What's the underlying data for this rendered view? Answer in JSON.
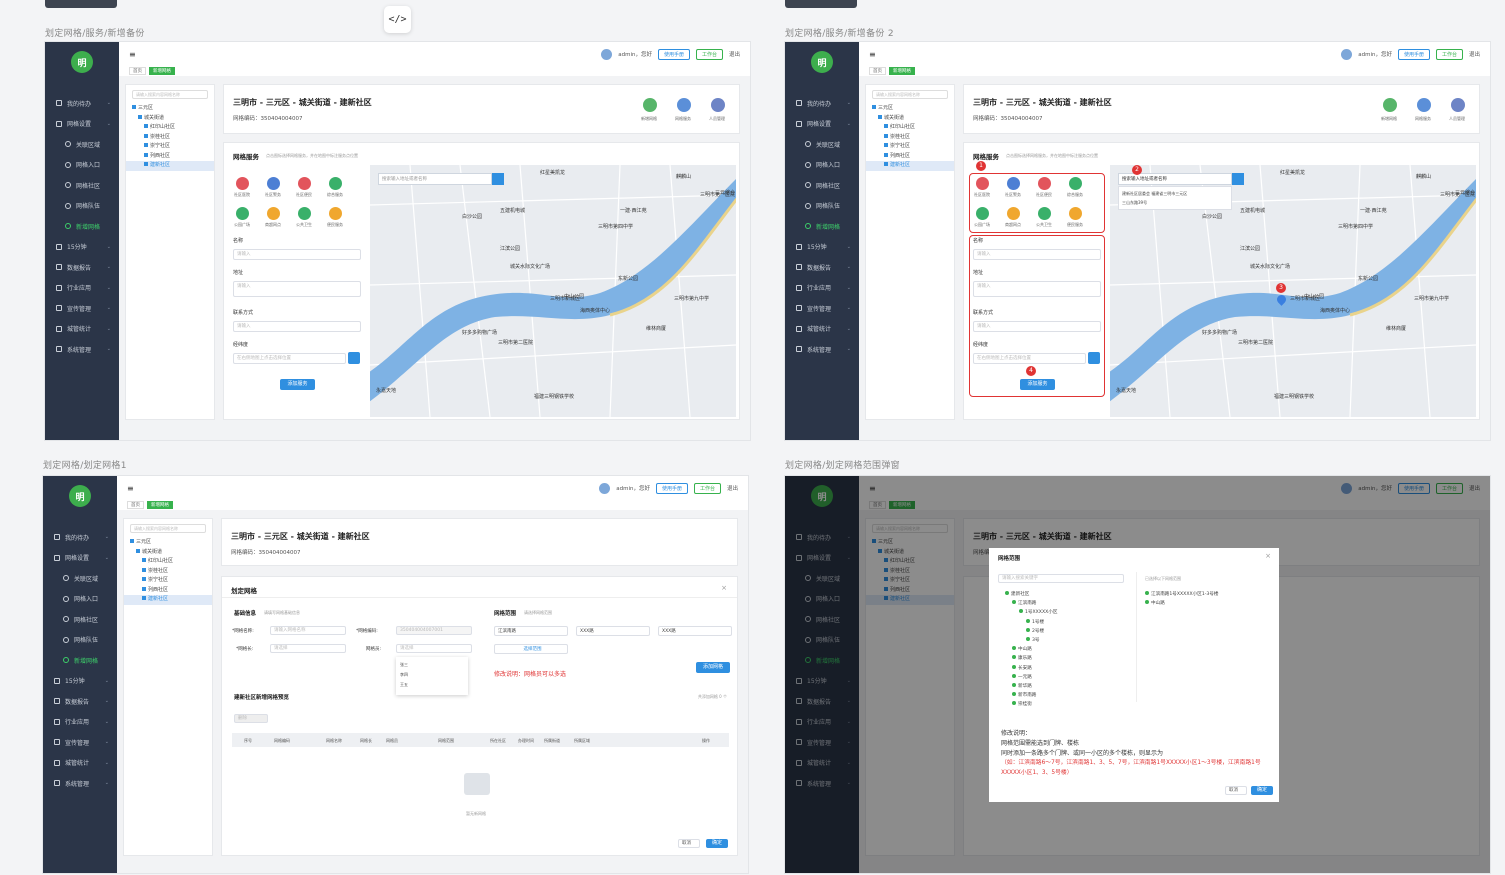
{
  "code_toggle": "</>",
  "frames": {
    "f1": {
      "title": "划定网格/服务/新增备份"
    },
    "f2": {
      "title": "划定网格/服务/新增备份 2"
    },
    "f3": {
      "title": "划定网格/划定网格1"
    },
    "f4": {
      "title": "划定网格/划定网格范围弹窗"
    }
  },
  "app": {
    "logo": "明",
    "menu_icon": "≡",
    "user": "admin，您好",
    "btn_manual": "使用手册",
    "btn_workbench": "工作台",
    "logout": "退出"
  },
  "nav": [
    {
      "label": "我的待办",
      "sub": false
    },
    {
      "label": "网格设置",
      "sub": false
    },
    {
      "label": "关联区域",
      "sub": true
    },
    {
      "label": "网格入口",
      "sub": true
    },
    {
      "label": "网格社区",
      "sub": true
    },
    {
      "label": "网格队伍",
      "sub": true
    },
    {
      "label": "新增网格",
      "sub": true
    },
    {
      "label": "15分钟",
      "sub": false
    },
    {
      "label": "数据报告",
      "sub": false
    },
    {
      "label": "行业应用",
      "sub": false
    },
    {
      "label": "宣传管理",
      "sub": false
    },
    {
      "label": "城管统计",
      "sub": false
    },
    {
      "label": "系统管理",
      "sub": false
    }
  ],
  "tabs": [
    "首页",
    "新增网格"
  ],
  "tree": {
    "search_placeholder": "请输入搜索内容网格名称",
    "nodes": [
      {
        "label": "三元区",
        "level": 0
      },
      {
        "label": "城关街道",
        "level": 1
      },
      {
        "label": "红印山社区",
        "level": 2
      },
      {
        "label": "崇桂社区",
        "level": 2
      },
      {
        "label": "崇宁社区",
        "level": 2
      },
      {
        "label": "列西社区",
        "level": 2
      },
      {
        "label": "建新社区",
        "level": 2
      }
    ]
  },
  "header": {
    "title": "三明市 - 三元区 - 城关街道 - 建新社区",
    "code": "网格编码：350404004007",
    "icons": [
      "新增网格",
      "网格服务",
      "人员管理"
    ]
  },
  "service": {
    "title": "网格服务",
    "hint": "点击图标选择网格服务，并在地图中标注服务点位置",
    "icons": [
      "社区医院",
      "社区警务",
      "社区便民",
      "综合服务",
      "公园广场",
      "商超网点",
      "公共卫生",
      "便民服务"
    ],
    "form": {
      "name_label": "名称",
      "name_placeholder": "请输入",
      "address_label": "地址",
      "address_placeholder": "请输入",
      "contact_label": "联系方式",
      "contact_placeholder": "请输入",
      "coords_label": "经纬度",
      "coords_placeholder": "在右侧地图上点击选择位置",
      "submit": "添加服务"
    },
    "map_search": "搜索输入地址或者名称",
    "map_suggest": [
      "建新社区居委会  福建省三明市三元区",
      "三山东路39号"
    ],
    "markers": [
      "1",
      "2",
      "3",
      "4"
    ]
  },
  "map_labels": [
    "红星美凯龙",
    "麒麟山",
    "三明市第一医院",
    "五建机电城",
    "一建·西江苑",
    "白沙公园",
    "三明市第四中学",
    "三元综合",
    "江滨公园",
    "城关水际文化广场",
    "东新公园",
    "三明市新城区",
    "三明市第九中学",
    "永嘉天地",
    "好多多购物广场",
    "中山公园",
    "海西奥体中心",
    "维林商厦",
    "三明市第二医院",
    "福建三明钢铁学校"
  ],
  "grid": {
    "panel_title": "划定网格",
    "basic_title": "基础信息",
    "basic_hint": "请填写网格基础信息",
    "name_label": "*网格名称:",
    "name_placeholder": "请输入网格名称",
    "code_label": "*网格编码:",
    "code_value": "350404004007001",
    "leader_label": "*网格长:",
    "leader_placeholder": "请选择",
    "member_label": "网格员:",
    "member_placeholder": "请选择",
    "member_options": [
      "张三",
      "李四",
      "王五"
    ],
    "range_title": "网格范围",
    "range_hint": "请选择网格范围",
    "range_tags": [
      "江滨南路",
      "XXX路",
      "XXX路"
    ],
    "range_button": "选择范围",
    "note": "修改说明：网格员可以多选",
    "add_btn": "添加网格",
    "list_title": "建新社区新增网格预览",
    "list_count": "共添加网格 0 个",
    "list_btn": "删除",
    "columns": [
      "序号",
      "网格编码",
      "网格名称",
      "网格长",
      "网格员",
      "网格范围",
      "所在社区",
      "办理时间",
      "所属街道",
      "所属区域",
      "操作"
    ],
    "empty": "暂无新网格",
    "cancel": "取消",
    "confirm": "确定"
  },
  "modal": {
    "title": "网格范围",
    "search_placeholder": "请输入搜索关键字",
    "selected_hint": "已选择以下网格范围",
    "tree": [
      "建新社区",
      "江滨南路",
      "1号XXXXX小区",
      "1号楼",
      "2号楼",
      "3号",
      "中山路",
      "康乐路",
      "长安路",
      "一元路",
      "新华路",
      "新市南路",
      "崇桂街"
    ],
    "selected": [
      "江滨南路1号XXXXX小区1-3号楼",
      "中山路"
    ],
    "note_lines": [
      "修改说明：",
      "网格范围需能选到门牌、楼栋",
      "同时添加一条路多个门牌、或同一小区的多个楼栋，则显示为"
    ],
    "note_red": "（如：江滨南路6～7号，江滨南路1、3、5、7号，江滨南路1号XXXXX小区1～3号楼，江滨南路1号XXXXX小区1、3、5号楼）",
    "cancel": "取消",
    "confirm": "确定"
  },
  "colors": {
    "accent": "#2f8fe0",
    "brand": "#3dae4d",
    "sidebar": "#2b3548",
    "highlight": "#e03434"
  }
}
